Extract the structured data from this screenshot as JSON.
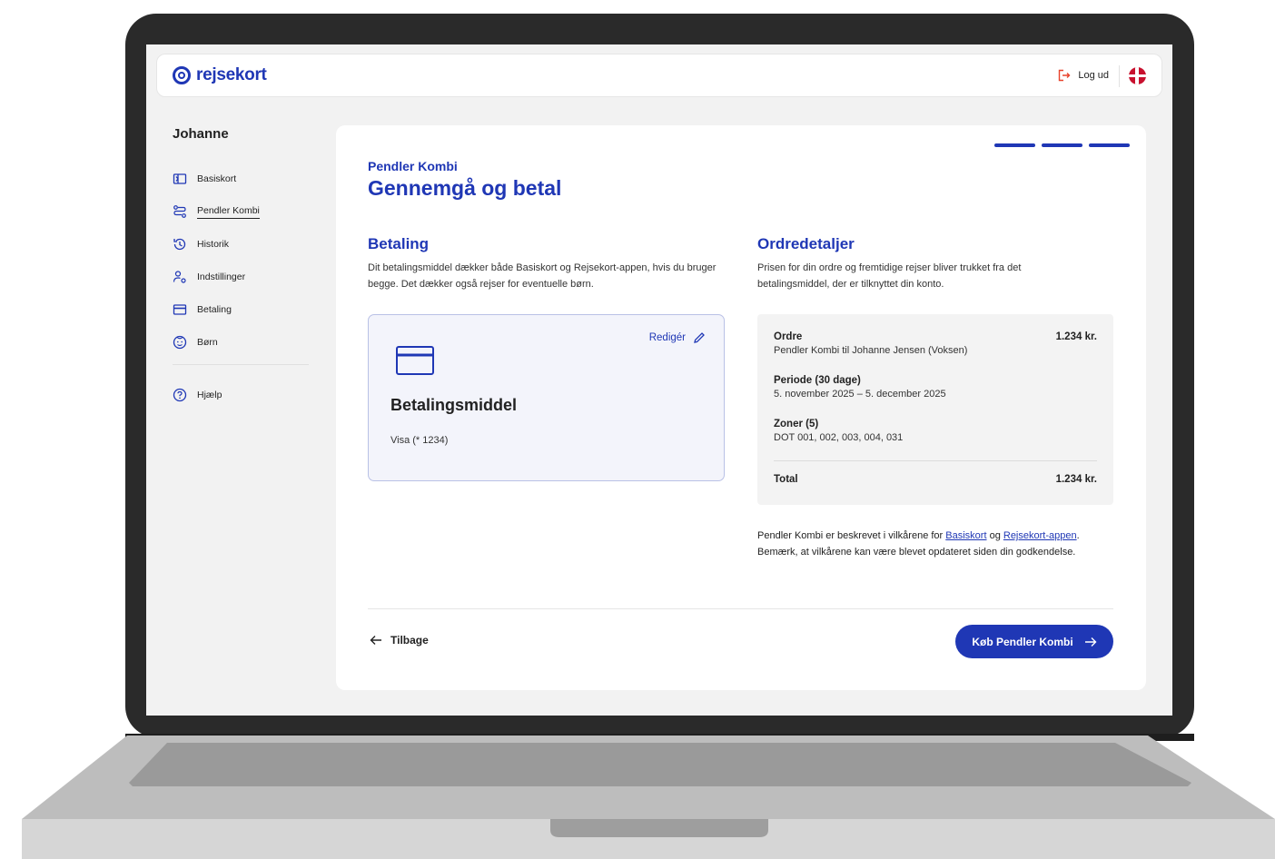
{
  "header": {
    "logo_text": "rejsekort",
    "logout_label": "Log ud"
  },
  "sidebar": {
    "user_name": "Johanne",
    "items": [
      {
        "label": "Basiskort",
        "icon": "card-chip-icon"
      },
      {
        "label": "Pendler Kombi",
        "icon": "route-icon"
      },
      {
        "label": "Historik",
        "icon": "history-icon"
      },
      {
        "label": "Indstillinger",
        "icon": "user-settings-icon"
      },
      {
        "label": "Betaling",
        "icon": "credit-card-icon"
      },
      {
        "label": "Børn",
        "icon": "child-face-icon"
      }
    ],
    "active_item": "Pendler Kombi",
    "help_label": "Hjælp"
  },
  "main": {
    "eyebrow": "Pendler Kombi",
    "title": "Gennemgå og betal",
    "steps_total": 3,
    "steps_completed": 3,
    "payment": {
      "title": "Betaling",
      "description": "Dit betalingsmiddel dækker både Basiskort og Rejsekort-appen, hvis du bruger begge. Det dækker også rejser for eventuelle børn.",
      "edit_label": "Redigér",
      "method_title": "Betalingsmiddel",
      "method_value": "Visa (* 1234)"
    },
    "order": {
      "title": "Ordredetaljer",
      "description": "Prisen for din ordre og fremtidige rejser bliver trukket fra det betalingsmiddel, der er tilknyttet din konto.",
      "order_label": "Ordre",
      "order_amount": "1.234 kr.",
      "order_text": "Pendler Kombi til Johanne Jensen (Voksen)",
      "period_label": "Periode (30 dage)",
      "period_text": "5. november 2025 – 5. december 2025",
      "zones_label": "Zoner (5)",
      "zones_text": "DOT 001, 002, 003, 004, 031",
      "total_label": "Total",
      "total_amount": "1.234 kr."
    },
    "terms": {
      "prefix": "Pendler Kombi er beskrevet i vilkårene for ",
      "link1": "Basiskort",
      "middle": " og ",
      "link2": "Rejsekort-appen",
      "suffix": ". Bemærk, at vilkårene kan være blevet opdateret siden din godkendelse."
    },
    "back_label": "Tilbage",
    "buy_label": "Køb Pendler Kombi"
  },
  "colors": {
    "brand_blue": "#1f37b5",
    "laptop_frame": "#2a2a2a",
    "flag_red": "#c8102e"
  }
}
